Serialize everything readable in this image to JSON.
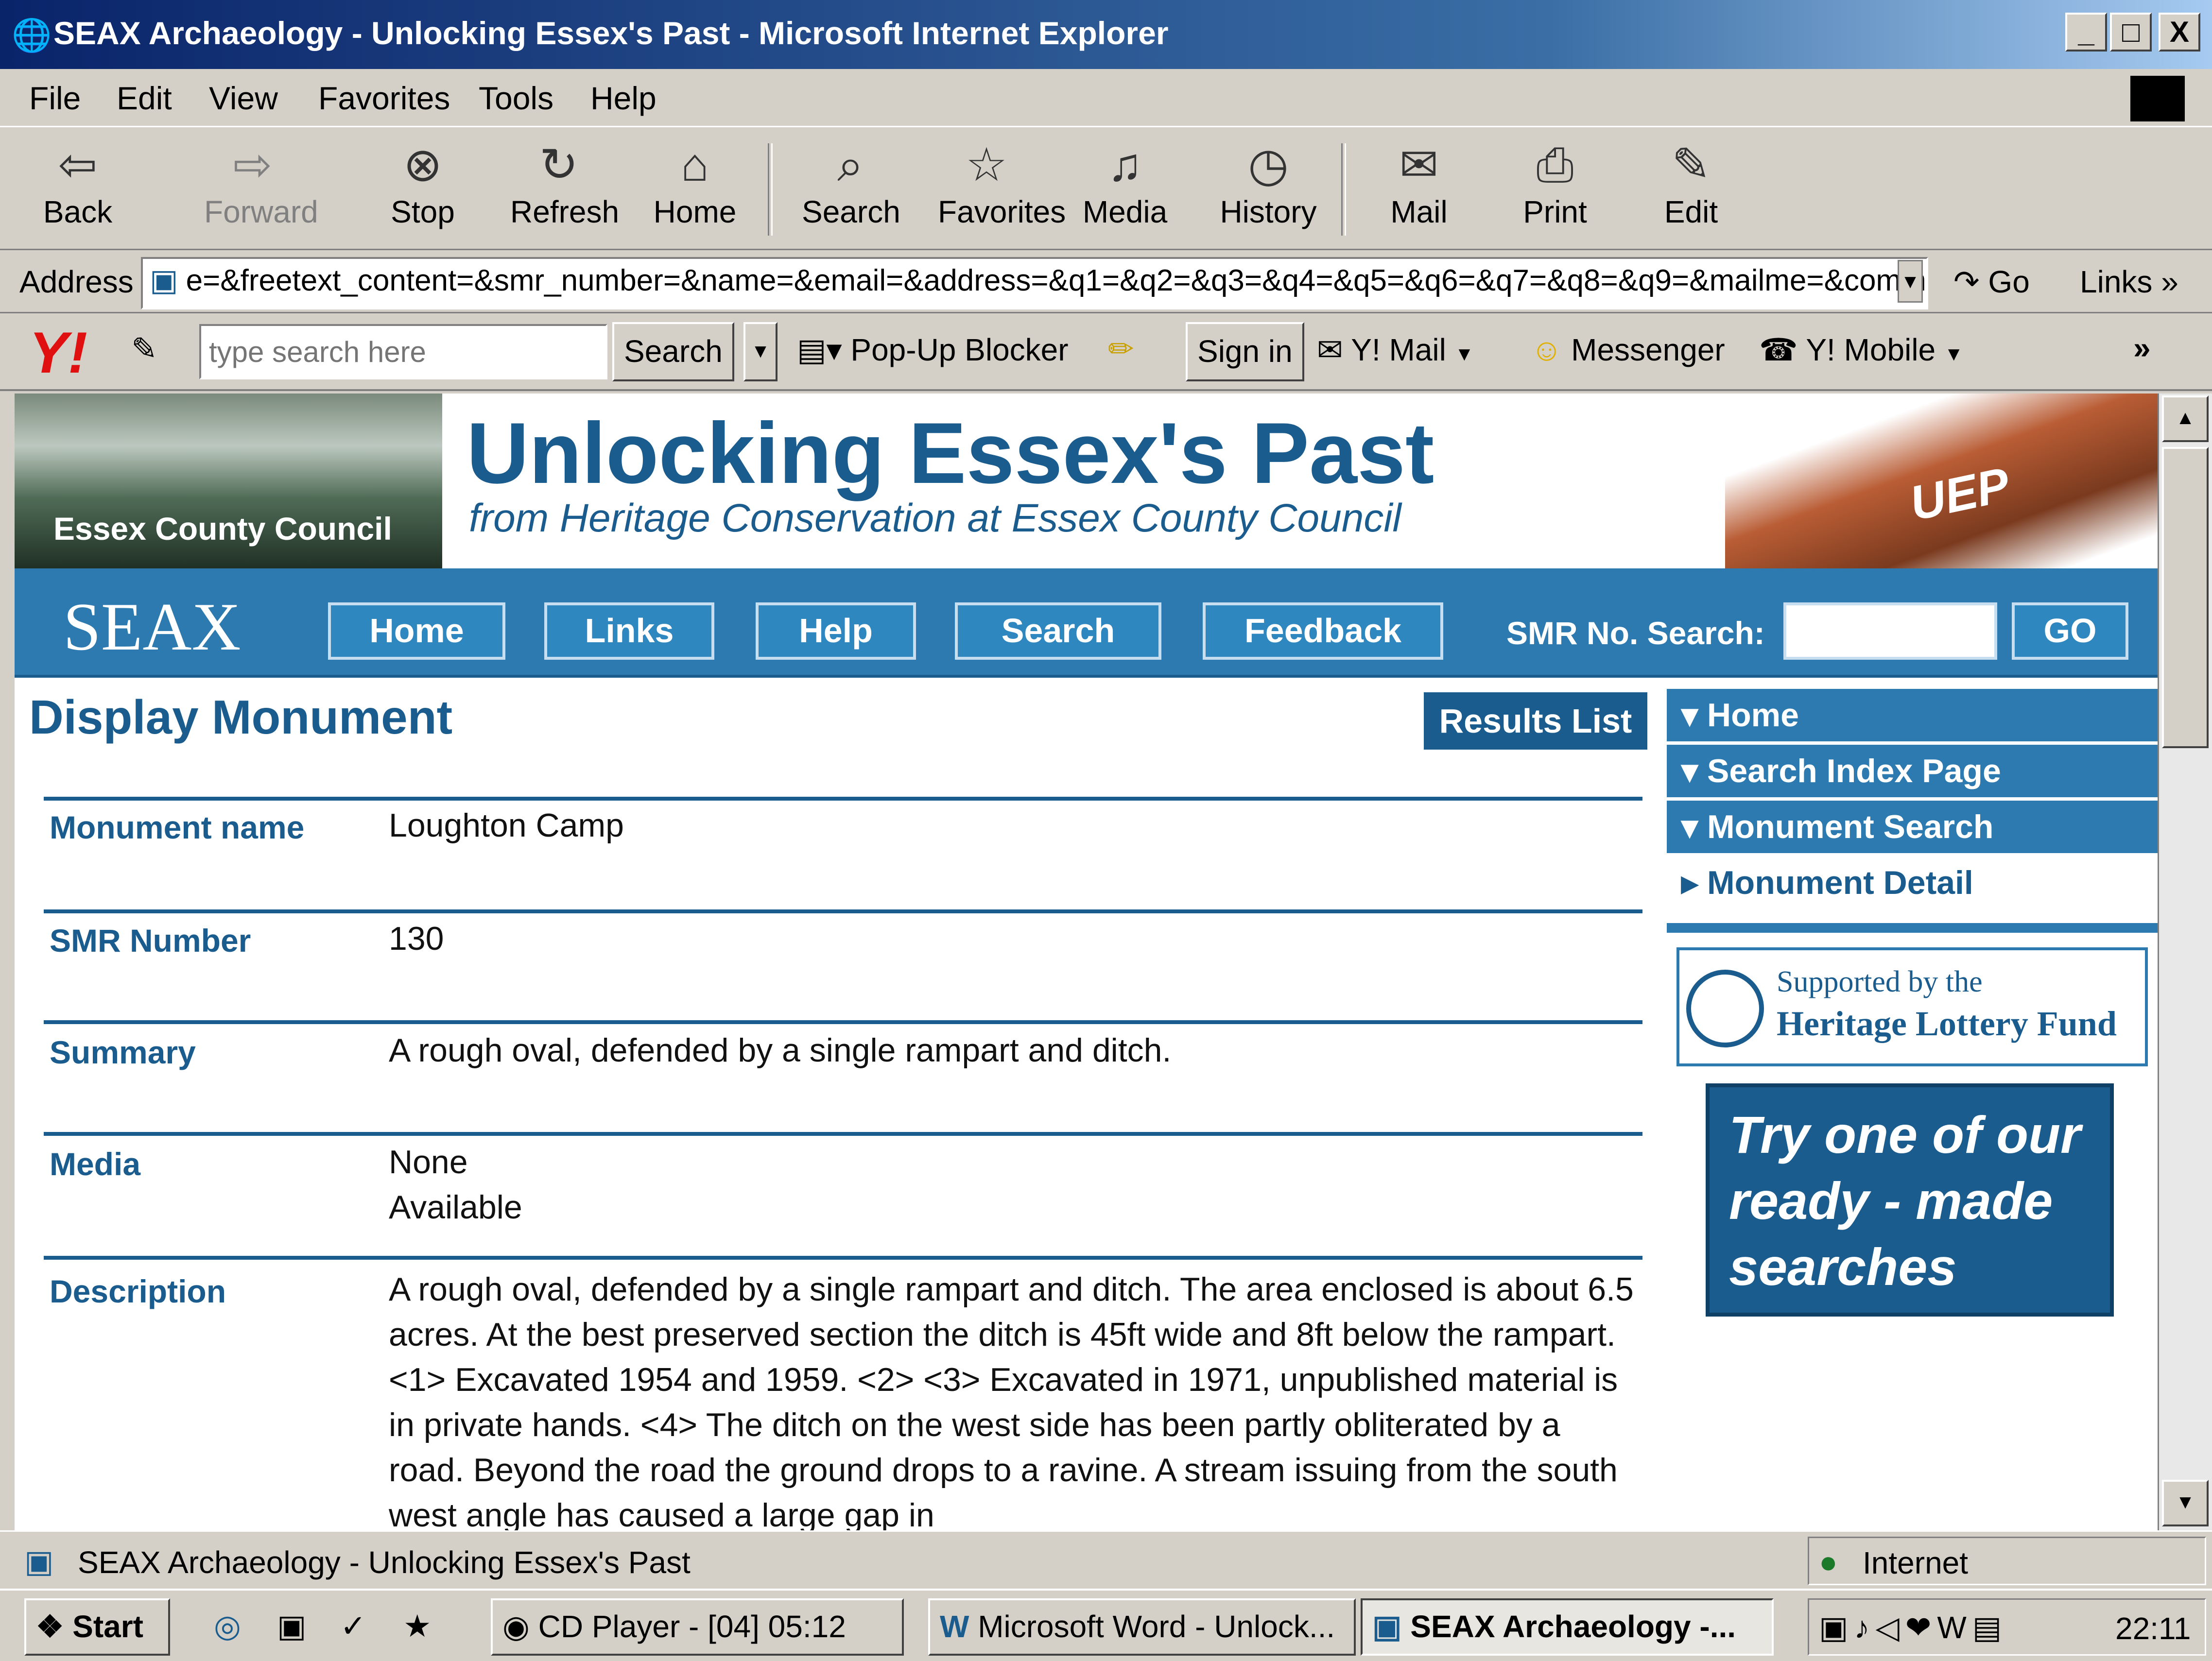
{
  "window": {
    "title": "SEAX Archaeology - Unlocking Essex's Past - Microsoft Internet Explorer",
    "controls": [
      "_",
      "□",
      "X"
    ]
  },
  "menu": [
    "File",
    "Edit",
    "View",
    "Favorites",
    "Tools",
    "Help"
  ],
  "toolbar": {
    "back": "Back",
    "forward": "Forward",
    "stop": "Stop",
    "refresh": "Refresh",
    "home": "Home",
    "search": "Search",
    "favorites": "Favorites",
    "media": "Media",
    "history": "History",
    "mail": "Mail",
    "print": "Print",
    "edit": "Edit"
  },
  "address": {
    "label": "Address",
    "url": "e=&freetext_content=&smr_number=&name=&email=&address=&q1=&q2=&q3=&q4=&q5=&q6=&q7=&q8=&q9=&mailme=&comments=",
    "go": "Go",
    "links": "Links"
  },
  "yahoo": {
    "logo": "Y!",
    "search_placeholder": "type search here",
    "search_button": "Search",
    "popup_blocker": "Pop-Up Blocker",
    "sign_in": "Sign in",
    "mail": "Y! Mail",
    "messenger": "Messenger",
    "mobile": "Y! Mobile"
  },
  "site": {
    "org": "Essex County Council",
    "title": "Unlocking Essex's Past",
    "subtitle": "from Heritage Conservation at Essex County Council",
    "chest_label": "UEP",
    "seax": "SEAX",
    "nav": [
      "Home",
      "Links",
      "Help",
      "Search",
      "Feedback"
    ],
    "smr_label": "SMR No. Search:",
    "go": "GO"
  },
  "main": {
    "heading": "Display Monument",
    "results_button": "Results List",
    "fields": [
      {
        "label": "Monument name",
        "value": "Loughton Camp"
      },
      {
        "label": "SMR Number",
        "value": "130"
      },
      {
        "label": "Summary",
        "value": "A rough oval, defended by a single rampart and ditch."
      },
      {
        "label": "Media",
        "value": "None\nAvailable"
      },
      {
        "label": "Description",
        "value": "A rough oval, defended by a single rampart and ditch. The area enclosed is about 6.5 acres. At the best preserved section the ditch is 45ft wide and 8ft below the rampart. <1> Excavated 1954 and 1959. <2> <3> Excavated in 1971, unpublished material is in private hands. <4> The ditch on the west side has been partly obliterated by a road. Beyond the road the ground drops to a ravine. A stream issuing from the south west angle has caused a large gap in"
      }
    ]
  },
  "sidebar": {
    "items": [
      "Home",
      "Search Index Page",
      "Monument Search",
      "Monument Detail"
    ],
    "hlf_line1": "Supported by the",
    "hlf_line2": "Heritage Lottery Fund",
    "promo": "Try one of our ready - made searches"
  },
  "status": {
    "text": "SEAX Archaeology - Unlocking Essex's Past",
    "zone": "Internet"
  },
  "taskbar": {
    "start": "Start",
    "tasks": [
      "CD Player - [04] 05:12",
      "Microsoft Word - Unlock...",
      "SEAX Archaeology -..."
    ],
    "clock": "22:11"
  },
  "colors": {
    "seax_blue": "#2c7ab0",
    "heading_blue": "#1b5c8e",
    "title_bar": "#0a246a"
  }
}
